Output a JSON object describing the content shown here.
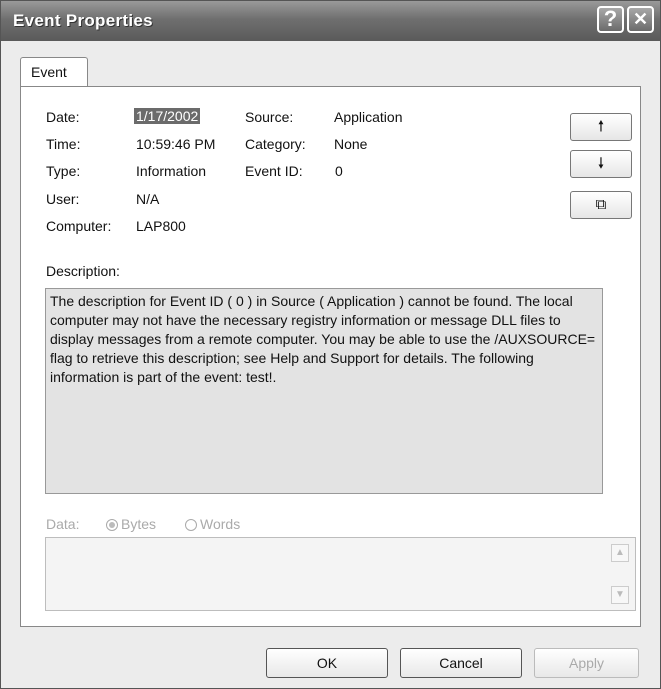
{
  "window": {
    "title": "Event Properties"
  },
  "titlebar_buttons": {
    "help_glyph": "?",
    "close_glyph": "✕"
  },
  "tabs": [
    {
      "label": "Event"
    }
  ],
  "fields": {
    "date_label": "Date:",
    "date_value": "1/17/2002",
    "time_label": "Time:",
    "time_value": "10:59:46 PM",
    "type_label": "Type:",
    "type_value": "Information",
    "user_label": "User:",
    "user_value": "N/A",
    "computer_label": "Computer:",
    "computer_value": "LAP800",
    "source_label": "Source:",
    "source_value": "Application",
    "category_label": "Category:",
    "category_value": "None",
    "eventid_label": "Event ID:",
    "eventid_value": "0"
  },
  "side_buttons": {
    "up_glyph": "🠕",
    "down_glyph": "🠗",
    "copy_glyph": "⧉"
  },
  "description": {
    "label": "Description:",
    "text": "The description for Event ID ( 0 ) in Source ( Application ) cannot be found. The local computer may not have the necessary registry information or message DLL files to display messages from a remote computer. You may be able to use the /AUXSOURCE= flag to retrieve this description; see Help and Support for details. The following information is part of the event: test!."
  },
  "data_section": {
    "label": "Data:",
    "bytes_label": "Bytes",
    "words_label": "Words",
    "selected": "Bytes"
  },
  "buttons": {
    "ok": "OK",
    "cancel": "Cancel",
    "apply": "Apply"
  },
  "colors": {
    "titlebar": "#6f6f6f",
    "selection": "#6b6b6b"
  }
}
